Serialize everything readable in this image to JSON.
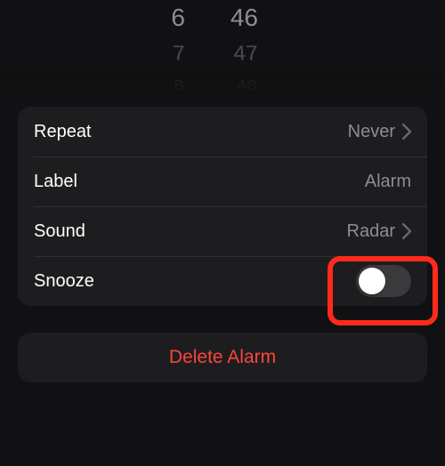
{
  "picker": {
    "hours": [
      "6",
      "7",
      "8"
    ],
    "minutes": [
      "46",
      "47",
      "48"
    ]
  },
  "settings": {
    "repeat": {
      "label": "Repeat",
      "value": "Never"
    },
    "label_row": {
      "label": "Label",
      "value": "Alarm"
    },
    "sound": {
      "label": "Sound",
      "value": "Radar"
    },
    "snooze": {
      "label": "Snooze",
      "on": false
    }
  },
  "delete_label": "Delete Alarm",
  "colors": {
    "destructive": "#ff453a",
    "highlight": "#ff2a1a"
  }
}
